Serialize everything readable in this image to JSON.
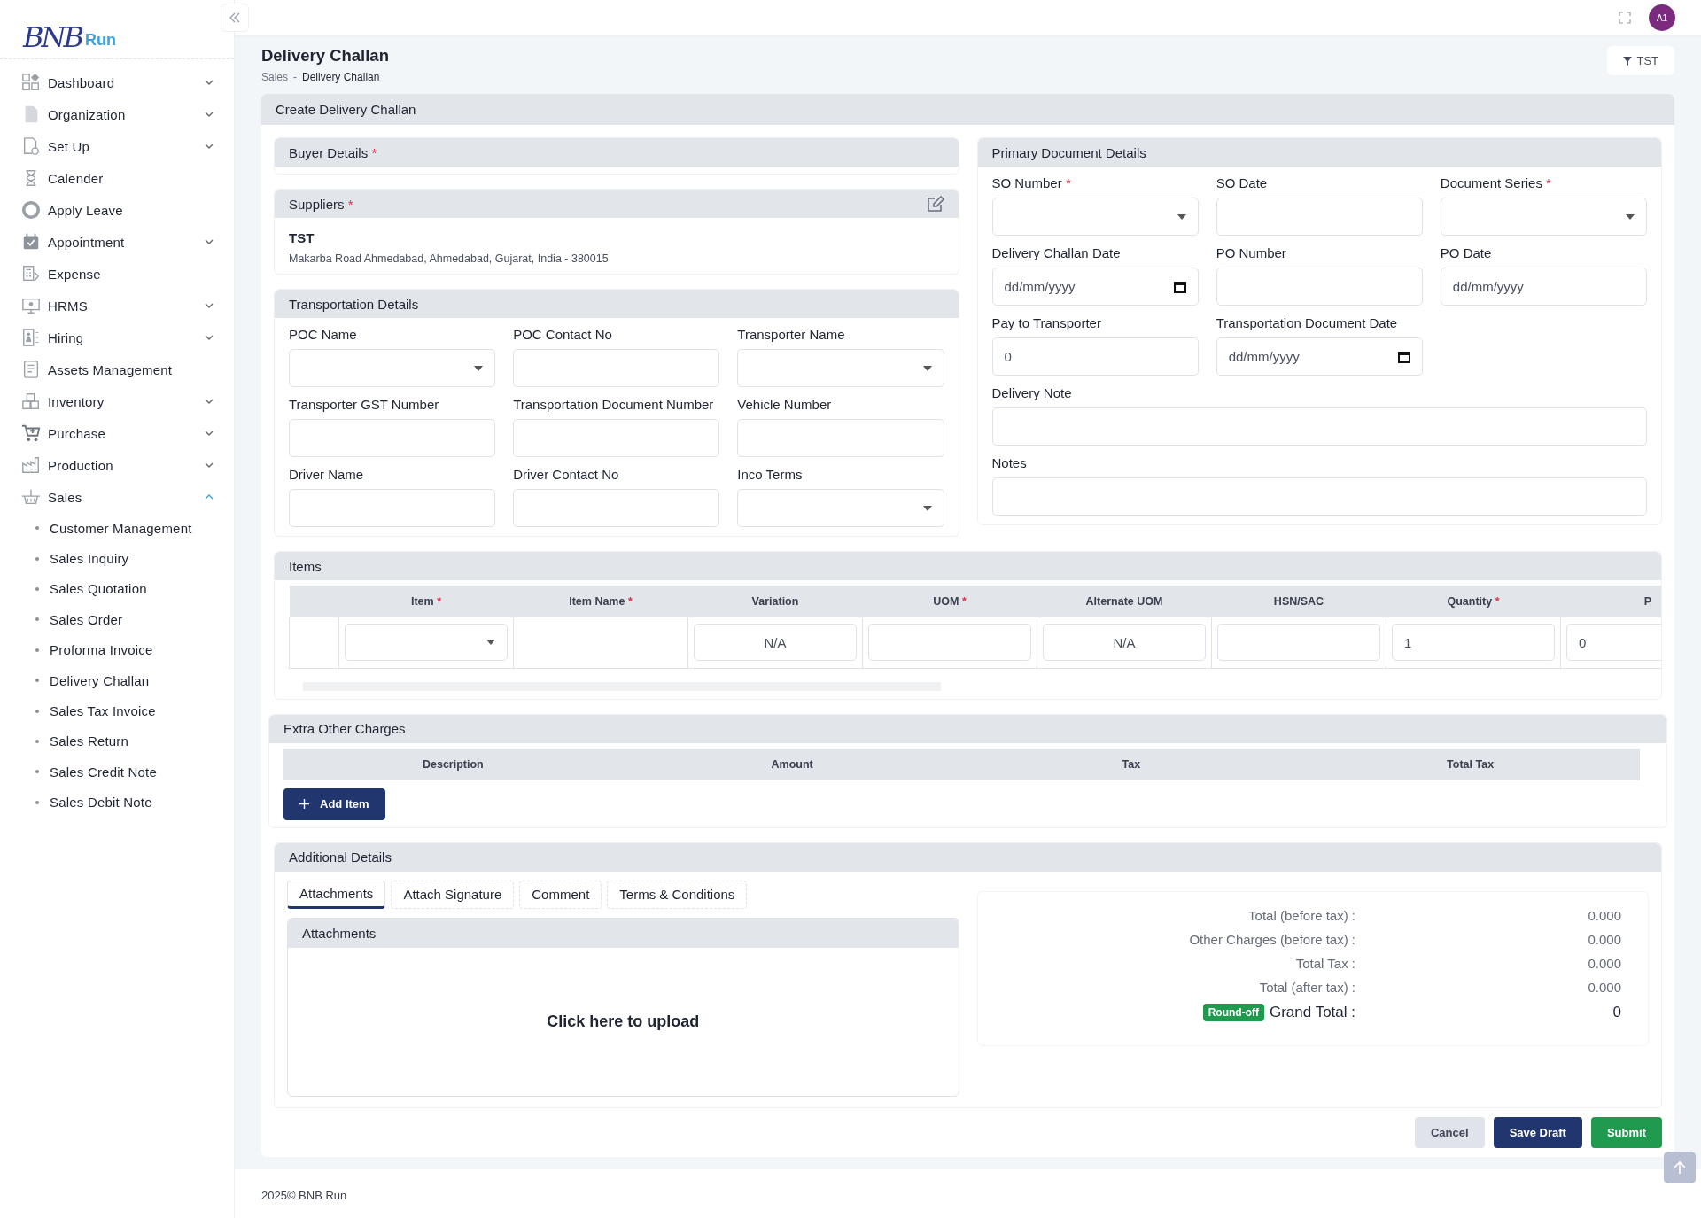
{
  "brand": {
    "mark": "BNB",
    "name": "Run"
  },
  "sidebar": {
    "items": [
      {
        "label": "Dashboard",
        "kind": "group",
        "expanded": false
      },
      {
        "label": "Organization",
        "kind": "group",
        "expanded": false
      },
      {
        "label": "Set Up",
        "kind": "group",
        "expanded": false
      },
      {
        "label": "Calender",
        "kind": "link"
      },
      {
        "label": "Apply Leave",
        "kind": "link"
      },
      {
        "label": "Appointment",
        "kind": "group",
        "expanded": false
      },
      {
        "label": "Expense",
        "kind": "link"
      },
      {
        "label": "HRMS",
        "kind": "group",
        "expanded": false
      },
      {
        "label": "Hiring",
        "kind": "group",
        "expanded": false
      },
      {
        "label": "Assets Management",
        "kind": "link"
      },
      {
        "label": "Inventory",
        "kind": "group",
        "expanded": false
      },
      {
        "label": "Purchase",
        "kind": "group",
        "expanded": false
      },
      {
        "label": "Production",
        "kind": "group",
        "expanded": false
      },
      {
        "label": "Sales",
        "kind": "group",
        "expanded": true,
        "children": [
          {
            "label": "Customer Management"
          },
          {
            "label": "Sales Inquiry"
          },
          {
            "label": "Sales Quotation"
          },
          {
            "label": "Sales Order"
          },
          {
            "label": "Proforma Invoice"
          },
          {
            "label": "Delivery Challan"
          },
          {
            "label": "Sales Tax Invoice"
          },
          {
            "label": "Sales Return"
          },
          {
            "label": "Sales Credit Note"
          },
          {
            "label": "Sales Debit Note"
          }
        ]
      }
    ]
  },
  "topbar": {
    "avatar": "A1"
  },
  "page": {
    "title": "Delivery Challan",
    "breadcrumb": [
      "Sales",
      "-",
      "Delivery Challan"
    ],
    "filter_button": "TST"
  },
  "form": {
    "title": "Create Delivery Challan",
    "buyer": {
      "title": "Buyer Details",
      "required_mark": "*"
    },
    "suppliers": {
      "title": "Suppliers",
      "required_mark": "*",
      "name": "TST",
      "address": "Makarba Road Ahmedabad, Ahmedabad, Gujarat, India - 380015"
    },
    "transportation": {
      "title": "Transportation Details",
      "fields": [
        {
          "label": "POC Name",
          "kind": "select"
        },
        {
          "label": "POC Contact No",
          "kind": "text"
        },
        {
          "label": "Transporter Name",
          "kind": "select"
        },
        {
          "label": "Transporter GST Number",
          "kind": "text"
        },
        {
          "label": "Transportation Document Number",
          "kind": "text"
        },
        {
          "label": "Vehicle Number",
          "kind": "text"
        },
        {
          "label": "Driver Name",
          "kind": "text"
        },
        {
          "label": "Driver Contact No",
          "kind": "text"
        },
        {
          "label": "Inco Terms",
          "kind": "select"
        }
      ]
    },
    "primary": {
      "title": "Primary Document Details",
      "fields": [
        {
          "label": "SO Number",
          "kind": "select",
          "required_mark": "*"
        },
        {
          "label": "SO Date",
          "kind": "text"
        },
        {
          "label": "Document Series",
          "kind": "select",
          "required_mark": "*"
        },
        {
          "label": "Delivery Challan Date",
          "kind": "date",
          "placeholder": "dd/mm/yyyy"
        },
        {
          "label": "PO Number",
          "kind": "text"
        },
        {
          "label": "PO Date",
          "kind": "text",
          "placeholder": "dd/mm/yyyy"
        },
        {
          "label": "Pay to Transporter",
          "kind": "text",
          "value": "0"
        },
        {
          "label": "Transportation Document Date",
          "kind": "date",
          "placeholder": "dd/mm/yyyy"
        }
      ],
      "wide_fields": [
        {
          "label": "Delivery Note"
        },
        {
          "label": "Notes"
        }
      ]
    },
    "items": {
      "title": "Items",
      "columns": [
        {
          "label": "Item",
          "required_mark": "*"
        },
        {
          "label": "Item Name",
          "required_mark": "*"
        },
        {
          "label": "Variation"
        },
        {
          "label": "UOM",
          "required_mark": "*"
        },
        {
          "label": "Alternate UOM"
        },
        {
          "label": "HSN/SAC"
        },
        {
          "label": "Quantity",
          "required_mark": "*"
        },
        {
          "label": "P"
        }
      ],
      "rows": [
        {
          "cells": [
            {
              "kind": "select"
            },
            {
              "kind": "blank"
            },
            {
              "kind": "readonly",
              "value": "N/A"
            },
            {
              "kind": "input"
            },
            {
              "kind": "readonly",
              "value": "N/A"
            },
            {
              "kind": "input"
            },
            {
              "kind": "input",
              "value": "1"
            },
            {
              "kind": "input",
              "value": "0"
            }
          ]
        }
      ]
    },
    "charges": {
      "title": "Extra Other Charges",
      "columns": [
        "Description",
        "Amount",
        "Tax",
        "Total Tax"
      ],
      "add_button": "Add Item"
    },
    "additional": {
      "title": "Additional Details",
      "tabs": [
        {
          "label": "Attachments",
          "selected": true
        },
        {
          "label": "Attach Signature",
          "selected": false
        },
        {
          "label": "Comment",
          "selected": false
        },
        {
          "label": "Terms & Conditions",
          "selected": false
        }
      ],
      "panel_title": "Attachments",
      "upload": "Click here to upload",
      "totals": [
        {
          "label": "Total (before tax) :",
          "value": "0.000"
        },
        {
          "label": "Other Charges (before tax) :",
          "value": "0.000"
        },
        {
          "label": "Total Tax :",
          "value": "0.000"
        },
        {
          "label": "Total (after tax) :",
          "value": "0.000"
        }
      ],
      "grand_total": {
        "badge": "Round-off",
        "label": "Grand Total :",
        "value": "0"
      }
    },
    "actions": [
      {
        "label": "Cancel",
        "kind": "secondary"
      },
      {
        "label": "Save Draft",
        "kind": "primary"
      },
      {
        "label": "Submit",
        "kind": "success"
      }
    ]
  },
  "footer": "2025© BNB Run"
}
